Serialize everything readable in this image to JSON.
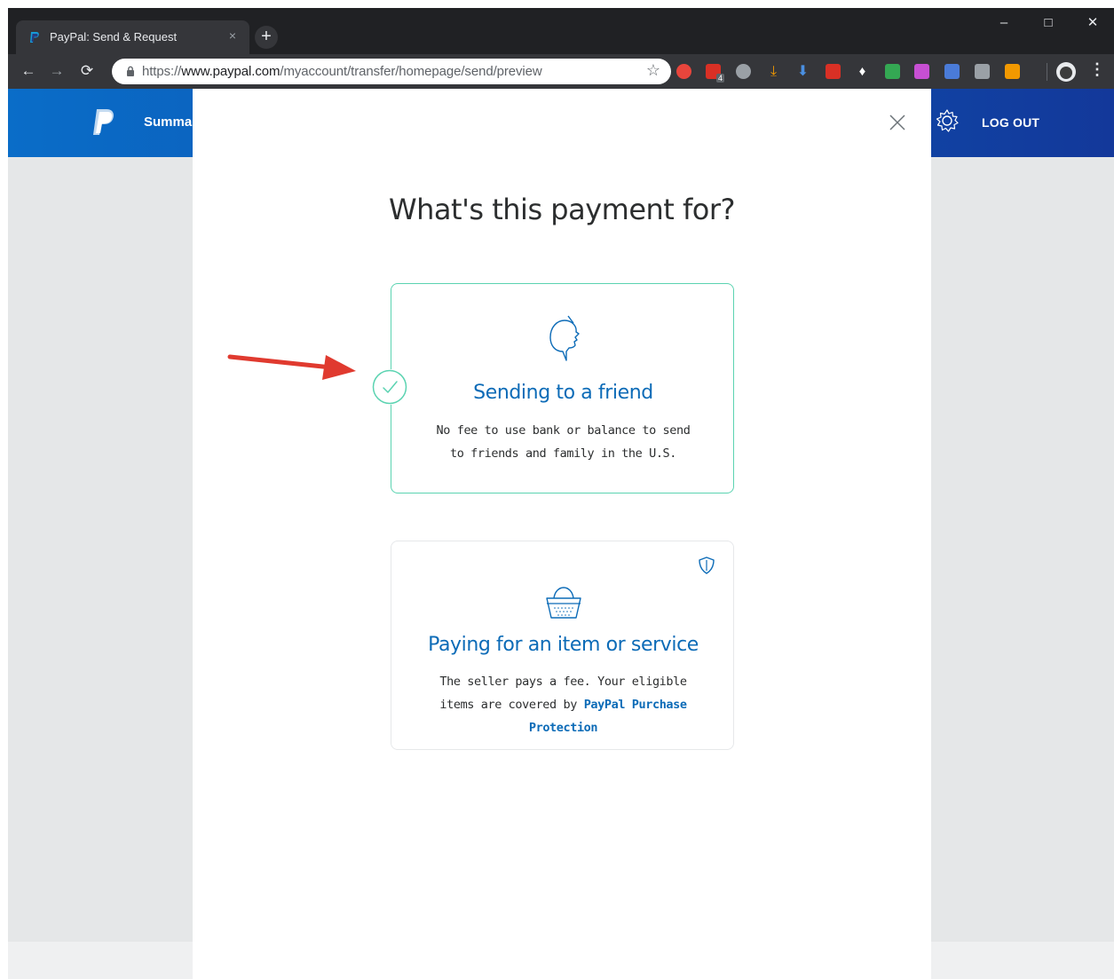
{
  "browser": {
    "tab_title": "PayPal: Send & Request",
    "tab_close": "×",
    "new_tab": "+",
    "url_prefix": "https://",
    "url_host": "www.paypal.com",
    "url_path": "/myaccount/transfer/homepage/send/preview",
    "extension_badge": "4",
    "window_minimize": "–",
    "window_maximize": "□",
    "window_close": "✕"
  },
  "header": {
    "nav_summary": "Summa",
    "logout": "LOG OUT"
  },
  "modal": {
    "title": "What's this payment for?",
    "options": [
      {
        "title": "Sending to a friend",
        "description": "No fee to use bank or balance to send to friends and family in the U.S.",
        "selected": true
      },
      {
        "title": "Paying for an item or service",
        "description_prefix": "The seller pays a fee. Your eligible items are covered by ",
        "description_link": "PayPal Purchase Protection",
        "selected": false
      }
    ]
  },
  "colors": {
    "paypal_blue": "#0c6bb7",
    "header_blue": "#0a6dc8",
    "selected_border": "#5bd3b1",
    "annotation_arrow": "#e03a2f"
  }
}
